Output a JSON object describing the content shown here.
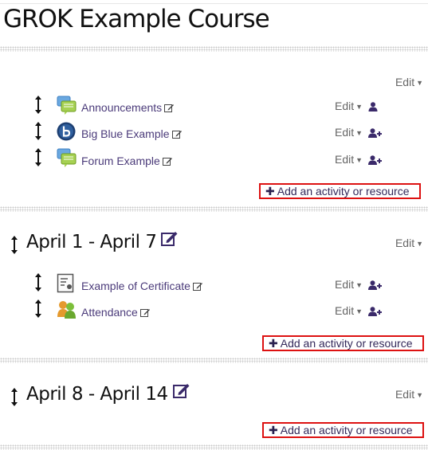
{
  "course": {
    "title": "GROK Example Course"
  },
  "labels": {
    "edit": "Edit",
    "add_activity": "Add an activity or resource"
  },
  "colors": {
    "link": "#4b3b7a",
    "highlight": "#dd1111"
  },
  "sections": [
    {
      "title": "",
      "activities": [
        {
          "name": "Announcements",
          "icon": "forum-icon",
          "role_icon": "user-icon"
        },
        {
          "name": "Big Blue Example",
          "icon": "bigbluebutton-icon",
          "role_icon": "add-user-icon"
        },
        {
          "name": "Forum Example",
          "icon": "forum-icon",
          "role_icon": "add-user-icon"
        }
      ]
    },
    {
      "title": "April 1 - April 7",
      "activities": [
        {
          "name": "Example of Certificate",
          "icon": "certificate-icon",
          "role_icon": "add-user-icon"
        },
        {
          "name": "Attendance",
          "icon": "attendance-icon",
          "role_icon": "add-user-icon"
        }
      ]
    },
    {
      "title": "April 8 - April 14",
      "activities": []
    }
  ]
}
